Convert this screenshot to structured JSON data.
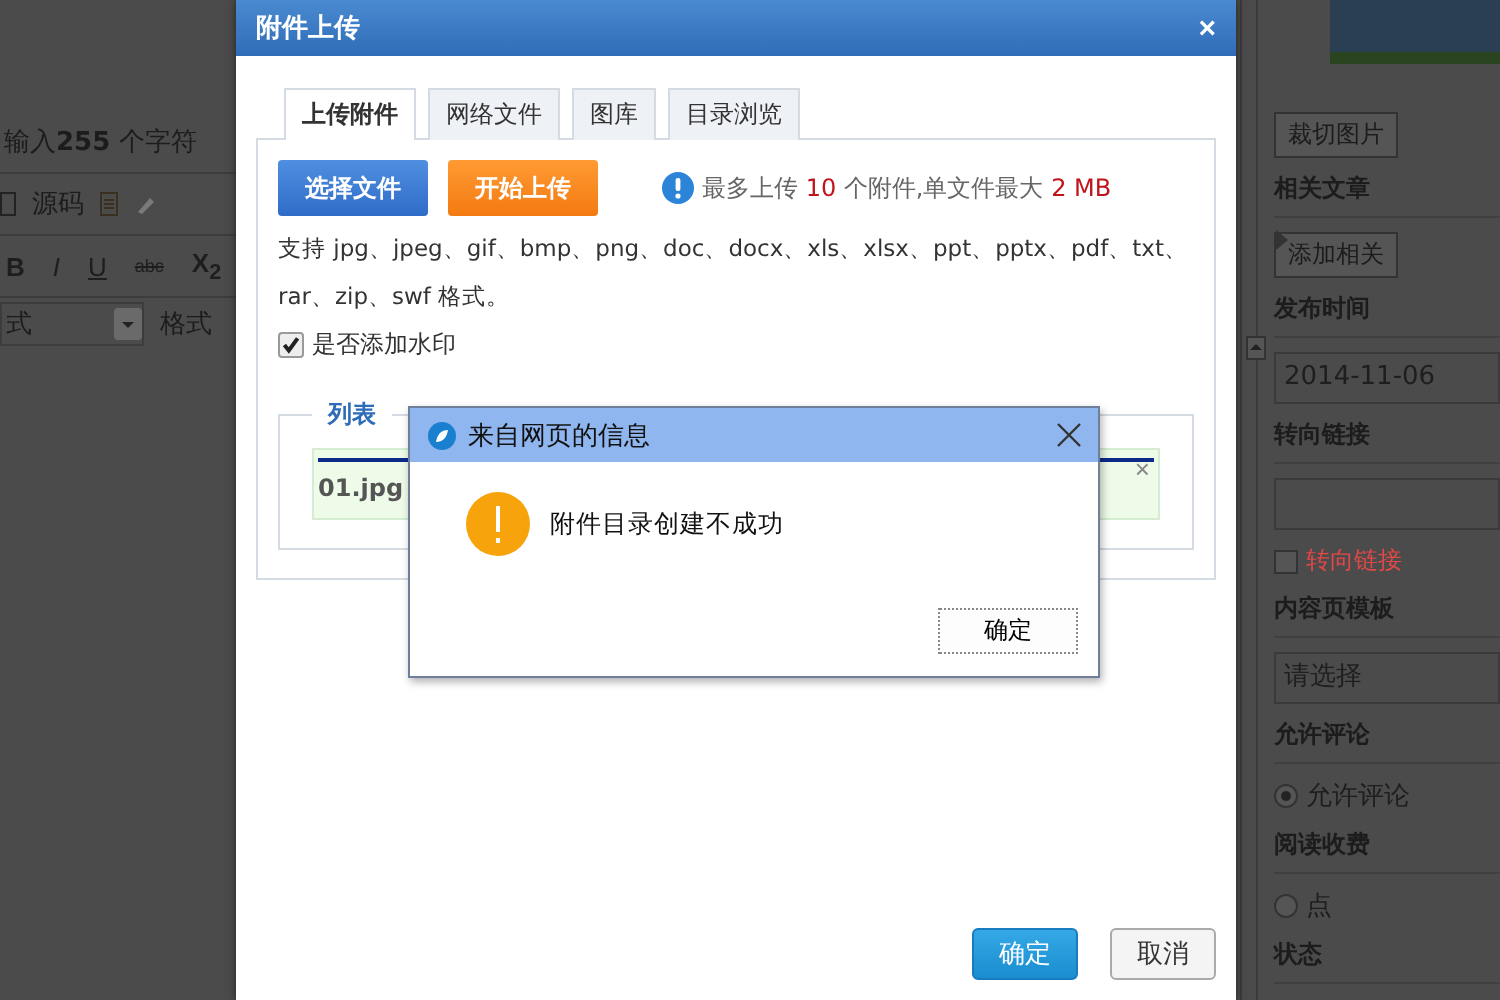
{
  "editor": {
    "char_hint": "输入**255** 个字符",
    "source_label": "源码",
    "format_buttons": [
      {
        "label": "B",
        "kind": "bold"
      },
      {
        "label": "I",
        "kind": "italic"
      },
      {
        "label": "U",
        "kind": "underline"
      },
      {
        "label": "abc",
        "kind": "strike"
      },
      {
        "label": "X$_{2}$",
        "kind": "sub"
      }
    ],
    "style_select": "式",
    "format_select": "格式"
  },
  "sidebar": {
    "items": [
      {
        "kind": "button",
        "label": "裁切图片"
      },
      {
        "kind": "heading",
        "label": "相关文章"
      },
      {
        "kind": "button",
        "label": "添加相关"
      },
      {
        "kind": "heading",
        "label": "发布时间"
      },
      {
        "kind": "input",
        "value": "2014-11-06"
      },
      {
        "kind": "heading",
        "label": "转向链接"
      },
      {
        "kind": "input",
        "value": ""
      },
      {
        "kind": "checkbox",
        "label": "转向链接",
        "checked": false
      },
      {
        "kind": "heading",
        "label": "内容页模板"
      },
      {
        "kind": "select",
        "value": "请选择"
      },
      {
        "kind": "heading",
        "label": "允许评论"
      },
      {
        "kind": "radio",
        "label": "允许评论",
        "selected": true
      },
      {
        "kind": "heading",
        "label": "阅读收费"
      },
      {
        "kind": "radio",
        "label": "点",
        "selected": false
      },
      {
        "kind": "heading",
        "label": "状态"
      }
    ]
  },
  "dialog": {
    "title": "附件上传",
    "close": "×",
    "tabs": [
      {
        "label": "上传附件",
        "selected": true
      },
      {
        "label": "网络文件",
        "selected": false
      },
      {
        "label": "图库",
        "selected": false
      },
      {
        "label": "目录浏览",
        "selected": false
      }
    ],
    "actions": [
      {
        "label": "选择文件",
        "kind": "blue"
      },
      {
        "label": "开始上传",
        "kind": "orange"
      }
    ],
    "info": [
      {
        "text": "最多上传 ",
        "highlight": false
      },
      {
        "text": "10",
        "highlight": true
      },
      {
        "text": " 个附件,单文件最大 ",
        "highlight": false
      },
      {
        "text": "2 MB",
        "highlight": true
      }
    ],
    "formats": "支持 jpg、jpeg、gif、bmp、png、doc、docx、xls、xlsx、ppt、pptx、pdf、txt、rar、zip、swf 格式。",
    "watermark": {
      "label": "是否添加水印",
      "checked": true
    },
    "list": {
      "legend": "列表",
      "files": [
        {
          "name": "01.jpg",
          "level": 1,
          "remove": "×"
        }
      ]
    },
    "footer": [
      {
        "label": "确定",
        "kind": "primary"
      },
      {
        "label": "取消",
        "kind": "secondary"
      }
    ]
  },
  "alert": {
    "title": "来自网页的信息",
    "message": "附件目录创建不成功",
    "button": "确定"
  }
}
